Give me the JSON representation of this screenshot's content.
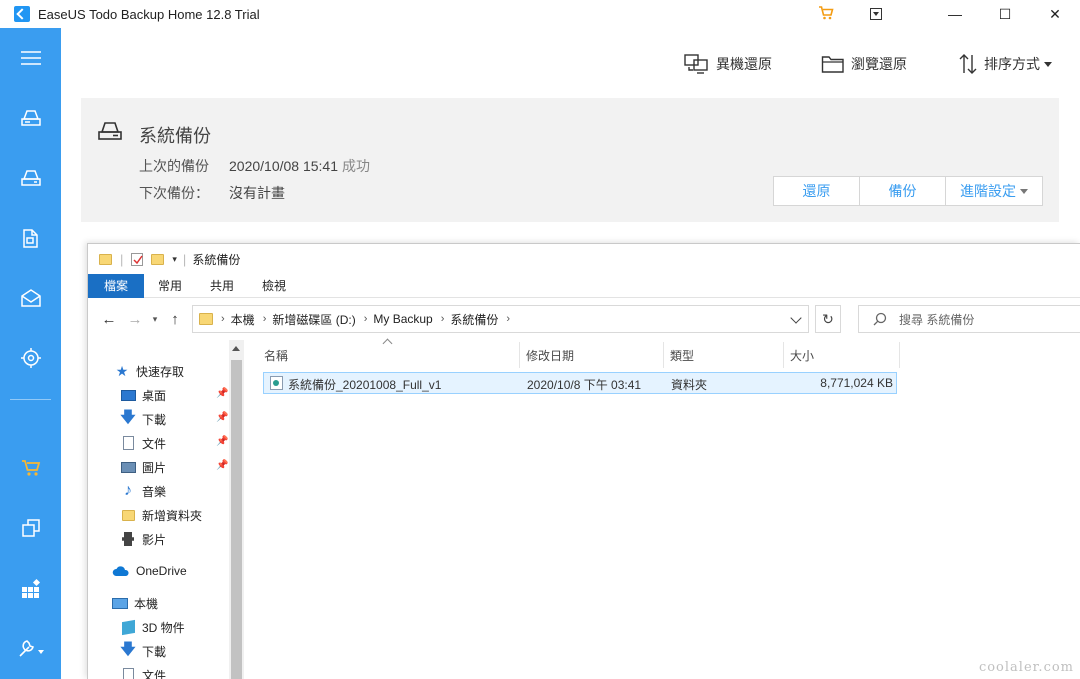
{
  "window": {
    "title": "EaseUS Todo Backup Home 12.8 Trial",
    "minimize": "—",
    "maximize": "☐",
    "close": "✕"
  },
  "toolbar": {
    "restore_other": "異機還原",
    "browse_restore": "瀏覽還原",
    "sort": "排序方式"
  },
  "backup_card": {
    "title": "系統備份",
    "last_label": "上次的備份",
    "last_value": "2020/10/08 15:41",
    "last_status": "成功",
    "next_label": "下次備份：",
    "next_value": "沒有計畫",
    "restore_button": "還原",
    "backup_button": "備份",
    "advanced_button": "進階設定"
  },
  "explorer": {
    "title": "系統備份",
    "ribbon_tabs": [
      "檔案",
      "常用",
      "共用",
      "檢視"
    ],
    "address": {
      "crumbs": [
        "本機",
        "新增磁碟區 (D:)",
        "My Backup",
        "系統備份"
      ]
    },
    "refresh": "↻",
    "search_placeholder": "搜尋 系統備份",
    "nav": {
      "quick_access": "快速存取",
      "desktop": "桌面",
      "downloads": "下載",
      "documents": "文件",
      "pictures": "圖片",
      "music": "音樂",
      "new_folder": "新增資料夾",
      "videos": "影片",
      "onedrive": "OneDrive",
      "this_pc": "本機",
      "objects3d": "3D 物件",
      "downloads2": "下載",
      "documents2": "文件"
    },
    "columns": {
      "name": "名稱",
      "modified": "修改日期",
      "type": "類型",
      "size": "大小"
    },
    "files": [
      {
        "name": "系統備份_20201008_Full_v1",
        "modified": "2020/10/8 下午 03:41",
        "type": "資料夾",
        "size": "8,771,024 KB"
      }
    ]
  },
  "watermark": "coolaler.com",
  "colors": {
    "sidebar": "#3a9df0",
    "accent": "#3a9df0",
    "ribbon_file": "#1a6fc4"
  }
}
